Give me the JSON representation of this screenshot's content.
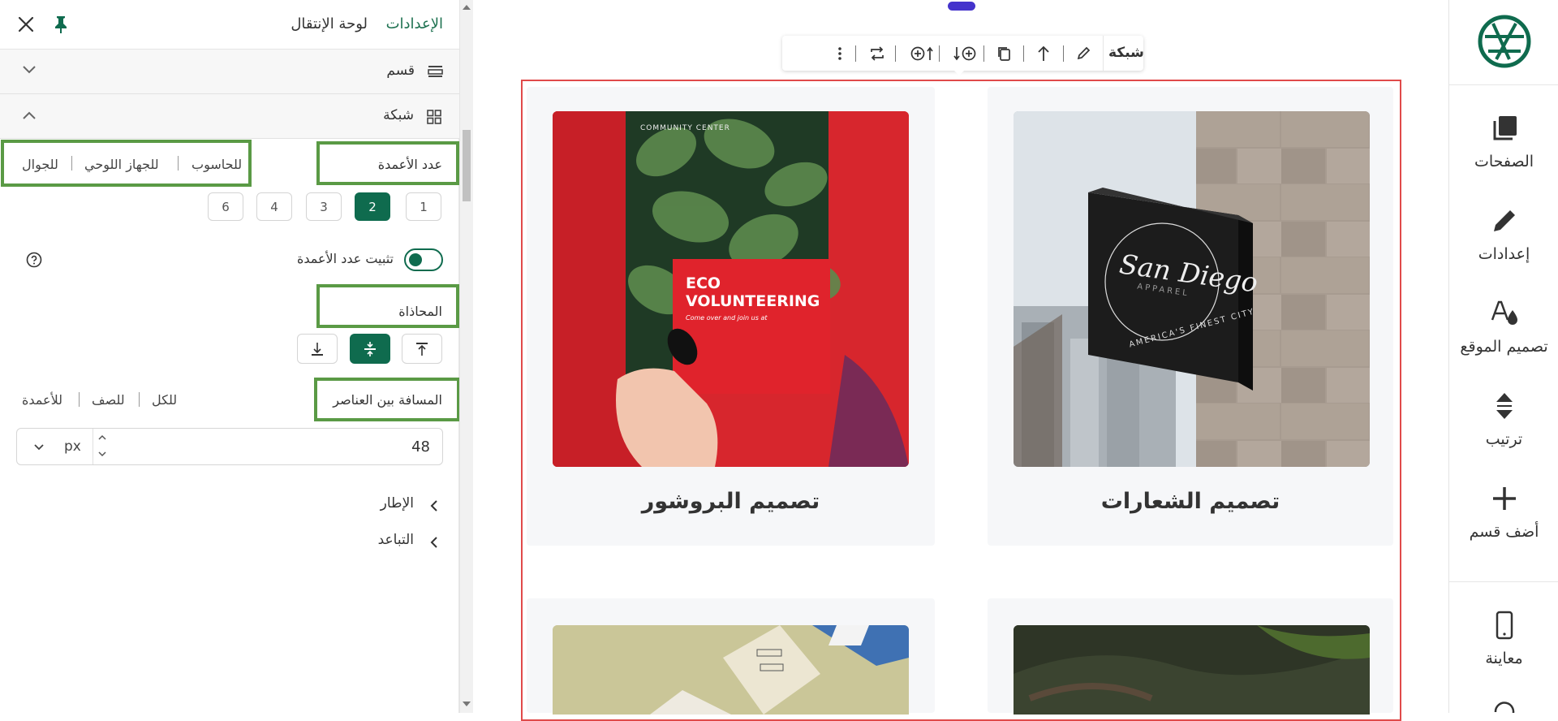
{
  "panel": {
    "tab_settings": "الإعدادات",
    "tab_navigator": "لوحة الإنتقال",
    "section_label": "قسم",
    "grid_label": "شبكة",
    "columns_label": "عدد الأعمدة",
    "devices": [
      "للحاسوب",
      "للجهاز اللوحي",
      "للجوال"
    ],
    "column_options": [
      "1",
      "2",
      "3",
      "4",
      "6"
    ],
    "selected_columns": "2",
    "fix_columns_label": "تثبيت عدد الأعمدة",
    "alignment_label": "المحاذاة",
    "spacing_label": "المسافة بين العناصر",
    "spacing_targets": [
      "للكل",
      "للصف",
      "للأعمدة"
    ],
    "spacing_value": "48",
    "spacing_unit": "px",
    "border_label": "الإطار",
    "distance_label": "التباعد"
  },
  "toolbar": {
    "label": "شبكة"
  },
  "cards": [
    {
      "title": "تصميم الشعارات"
    },
    {
      "title": "تصميم البروشور"
    }
  ],
  "brochure": {
    "community": "COMMUNITY CENTER",
    "line1": "ECO",
    "line2": "VOLUNTEERING",
    "sub": "Come over and join us at"
  },
  "sign": {
    "brand": "San Diego",
    "apparel": "APPAREL",
    "tagline": "AMERICA'S FINEST CITY"
  },
  "rail": {
    "pages": "الصفحات",
    "settings": "إعدادات",
    "design": "تصميم الموقع",
    "order": "ترتيب",
    "add_section": "أضف قسم",
    "preview": "معاينة"
  },
  "colors": {
    "accent": "#0f6b4e",
    "highlight": "#5a9a45",
    "selection": "#e04a4a",
    "handle": "#4433cc"
  }
}
